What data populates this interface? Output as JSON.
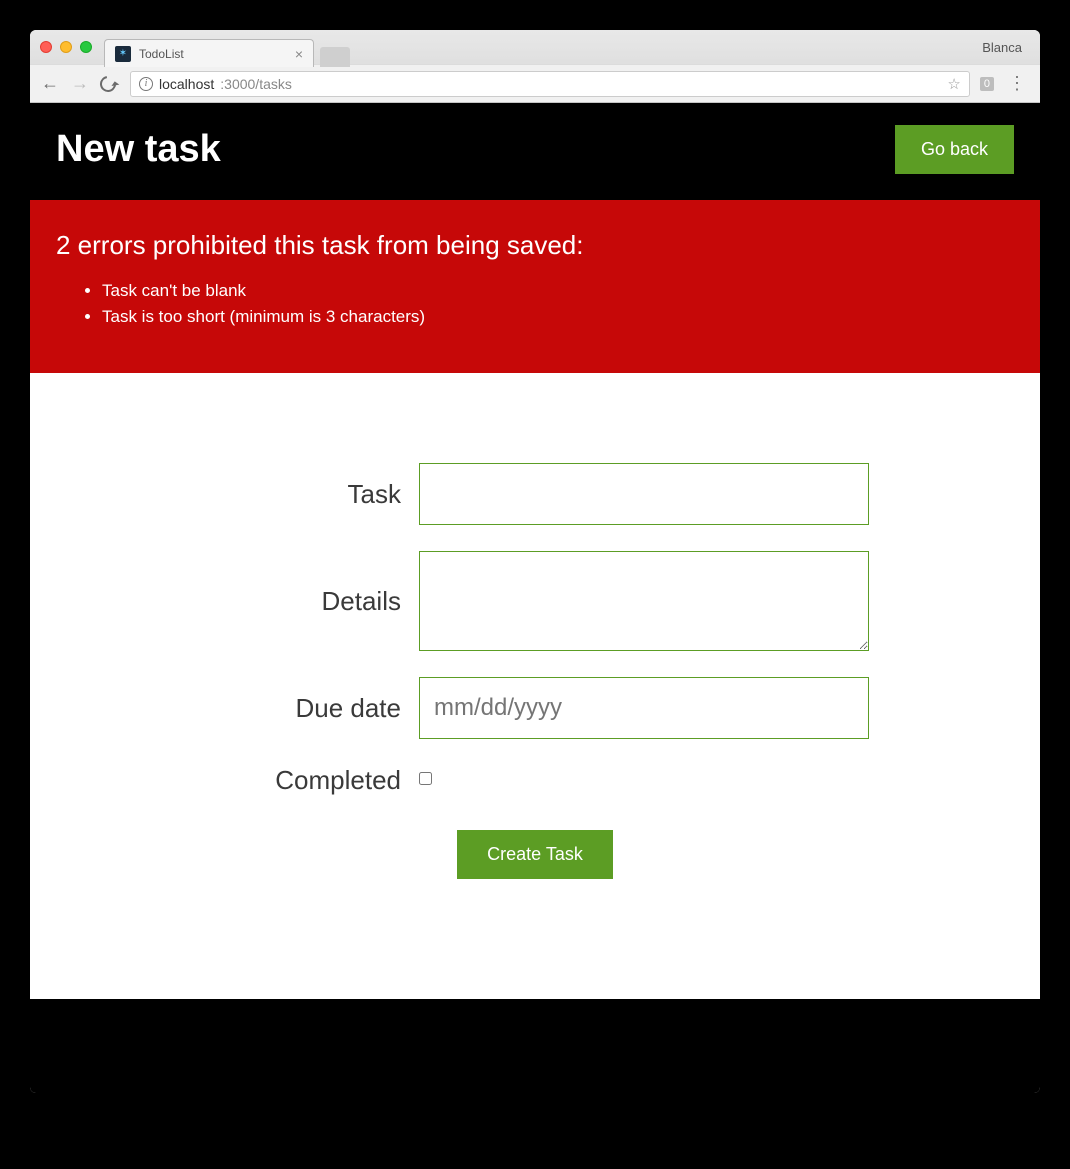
{
  "browser": {
    "tab_title": "TodoList",
    "profile": "Blanca",
    "url_host": "localhost",
    "url_path": ":3000/tasks",
    "ext_badge": "0"
  },
  "header": {
    "title": "New task",
    "back_button": "Go back"
  },
  "errors": {
    "title": "2 errors prohibited this task from being saved:",
    "items": [
      "Task can't be blank",
      "Task is too short (minimum is 3 characters)"
    ]
  },
  "form": {
    "task_label": "Task",
    "task_value": "",
    "details_label": "Details",
    "details_value": "",
    "due_label": "Due date",
    "due_placeholder": "mm/dd/yyyy",
    "completed_label": "Completed",
    "submit": "Create Task"
  },
  "colors": {
    "accent_green": "#5c9d24",
    "error_red": "#c60808"
  }
}
